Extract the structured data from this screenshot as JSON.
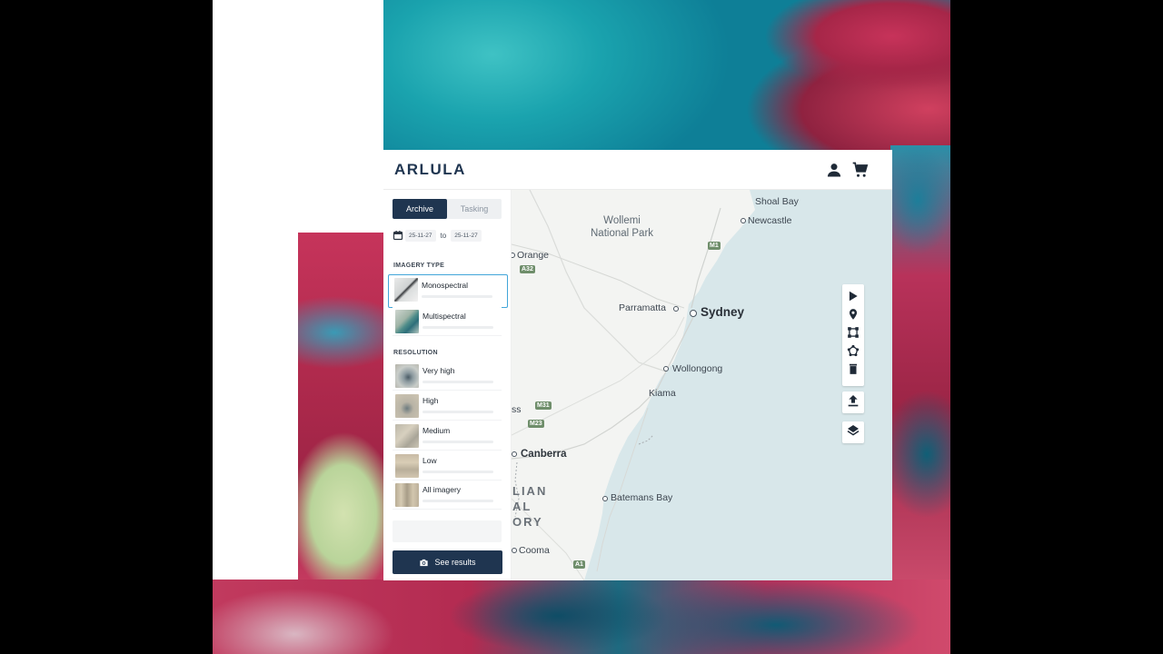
{
  "app": {
    "logo": "ARLULA"
  },
  "header": {
    "icons": [
      "user-icon",
      "cart-icon"
    ]
  },
  "sidebar": {
    "tabs": [
      {
        "label": "Archive",
        "active": true
      },
      {
        "label": "Tasking",
        "active": false
      }
    ],
    "date_from": "25-11-27",
    "date_sep": "to",
    "date_to": "25-11-27",
    "imagery_type_label": "IMAGERY TYPE",
    "imagery_types": [
      {
        "label": "Monospectral",
        "selected": true
      },
      {
        "label": "Multispectral",
        "selected": false
      }
    ],
    "resolution_label": "RESOLUTION",
    "resolutions": [
      {
        "label": "Very high"
      },
      {
        "label": "High"
      },
      {
        "label": "Medium"
      },
      {
        "label": "Low"
      },
      {
        "label": "All imagery"
      }
    ],
    "see_results_label": "See results"
  },
  "map": {
    "places": {
      "shoal_bay": "Shoal Bay",
      "newcastle": "Newcastle",
      "wollemi": "Wollemi",
      "national_park": "National Park",
      "orange": "Orange",
      "parramatta": "Parramatta",
      "sydney": "Sydney",
      "wollongong": "Wollongong",
      "kiama": "Kiama",
      "goulburn_partial": "ss",
      "canberra": "Canberra",
      "region_line1": "LIAN",
      "region_line2": "AL",
      "region_line3": "ORY",
      "batemans_bay": "Batemans Bay",
      "cooma": "Cooma"
    },
    "shields": {
      "m1": "M1",
      "a32": "A32",
      "m31": "M31",
      "m23": "M23",
      "a1": "A1"
    },
    "tools": [
      "cursor-icon",
      "pin-icon",
      "rectangle-icon",
      "polygon-icon",
      "trash-icon",
      "upload-icon",
      "layers-icon"
    ],
    "colors": {
      "land": "#f3f4f2",
      "sea": "#d8e7ea",
      "accent": "#1f3550",
      "selected_border": "#42a6d9"
    }
  }
}
